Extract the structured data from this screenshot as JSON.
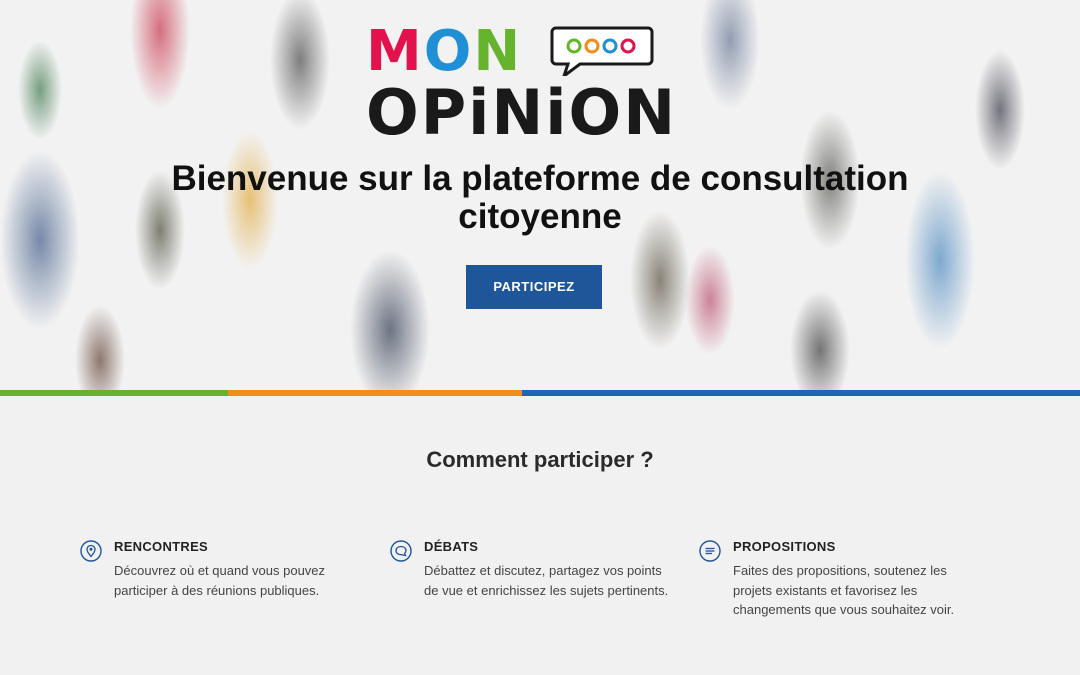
{
  "colors": {
    "accent_blue": "#1f5599",
    "stripe_green": "#6aaf2e",
    "stripe_orange": "#f28c1a",
    "stripe_blue": "#1f65b3",
    "mon_m": "#e3124c",
    "mon_o": "#1f8fd6",
    "mon_n": "#66b32e"
  },
  "logo": {
    "line1": "MON",
    "line2": "OPiNiON"
  },
  "hero": {
    "title_line1": "Bienvenue sur la plateforme de consultation",
    "title_line2": "citoyenne",
    "cta_label": "PARTICIPEZ"
  },
  "how": {
    "title": "Comment participer ?",
    "features": [
      {
        "icon": "map-pin-icon",
        "title": "RENCONTRES",
        "text": "Découvrez où et quand vous pouvez participer à des réunions publiques."
      },
      {
        "icon": "speech-bubble-icon",
        "title": "DÉBATS",
        "text": "Débattez et discutez, partagez vos points de vue et enrichissez les sujets pertinents."
      },
      {
        "icon": "list-lines-icon",
        "title": "PROPOSITIONS",
        "text": "Faites des propositions, soutenez les projets existants et favorisez les changements que vous souhaitez voir."
      }
    ]
  }
}
